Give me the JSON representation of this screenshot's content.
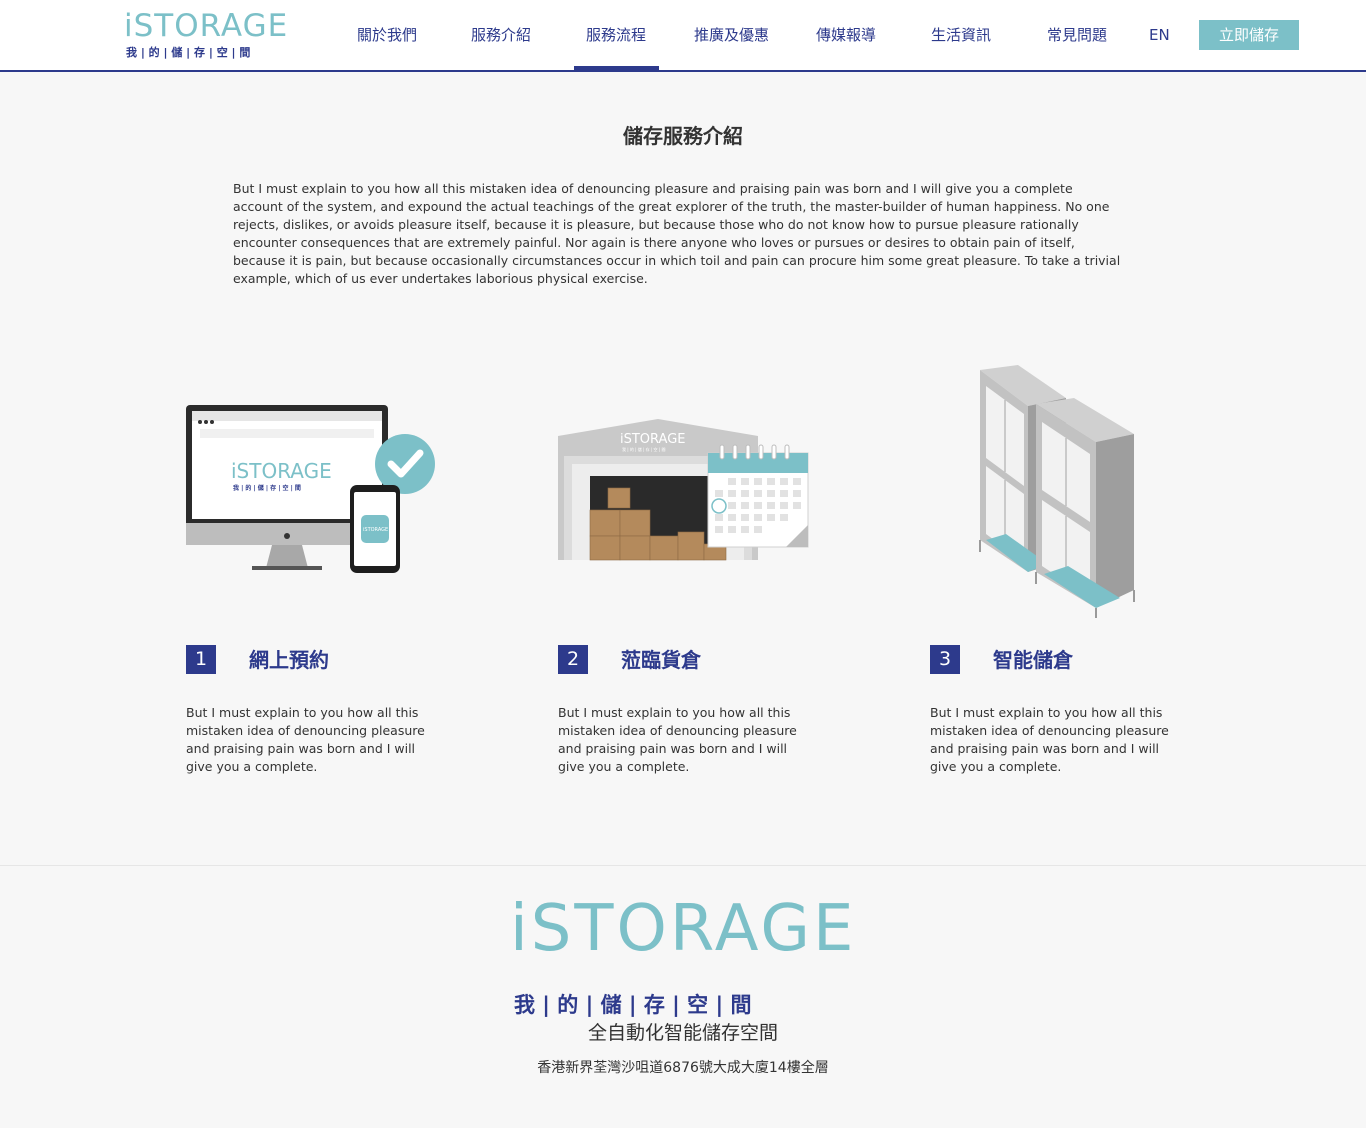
{
  "brand": {
    "logo_word": "iSTORAGE",
    "logo_sub": "我 | 的 | 儲 | 存 | 空 | 間"
  },
  "nav": {
    "items": [
      {
        "label": "關於我們"
      },
      {
        "label": "服務介紹"
      },
      {
        "label": "服務流程"
      },
      {
        "label": "推廣及優惠"
      },
      {
        "label": "傳媒報導"
      },
      {
        "label": "生活資訊"
      },
      {
        "label": "常見問題"
      },
      {
        "label": "EN"
      }
    ],
    "active_index": 2,
    "cta_label": "立即儲存"
  },
  "intro": {
    "title": "儲存服務介紹",
    "text": "But I must explain to you how all this mistaken idea of denouncing pleasure and praising pain was born and I will give you a complete account of the system, and expound the actual teachings of the great explorer of the truth, the master-builder of human happiness. No one rejects, dislikes, or avoids pleasure itself, because it is pleasure, but because those who do not know how to pursue pleasure rationally encounter consequences that are extremely painful. Nor again is there anyone who loves or pursues or desires to obtain pain of itself, because it is pain, but because occasionally circumstances occur in which toil and pain can procure him some great pleasure. To take a trivial example, which of us ever undertakes laborious physical exercise."
  },
  "steps": [
    {
      "number": "1",
      "title": "網上預約",
      "desc": "But I must explain to you how all this mistaken idea of denouncing pleasure and praising pain was born and I will give you a complete.",
      "illus_logo": "iSTORAGE",
      "illus_sub": "我 | 的 | 儲 | 存 | 空 | 間",
      "illus_app": "iSTORAGE"
    },
    {
      "number": "2",
      "title": "蒞臨貨倉",
      "desc": "But I must explain to you how all this mistaken idea of denouncing pleasure and praising pain was born and I will give you a complete.",
      "illus_logo": "iSTORAGE",
      "illus_sub": "我 | 的 | 儲 | 存 | 空 | 間"
    },
    {
      "number": "3",
      "title": "智能儲倉",
      "desc": "But I must explain to you how all this mistaken idea of denouncing pleasure and praising pain was born and I will give you a complete."
    }
  ],
  "footer": {
    "logo_word": "iSTORAGE",
    "logo_sub": "我 | 的 | 儲 | 存 | 空 | 間",
    "tagline": "全自動化智能儲存空間",
    "address": "香港新界荃灣沙咀道6876號大成大廈14樓全層"
  },
  "colors": {
    "brand_teal": "#7cc0c8",
    "brand_navy": "#2d3a8c",
    "background": "#f7f7f7"
  }
}
